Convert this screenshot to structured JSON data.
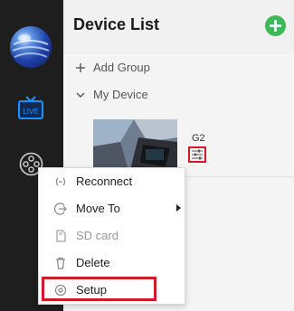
{
  "header": {
    "title": "Device List"
  },
  "tree": {
    "add_group_label": "Add Group",
    "my_device_label": "My Device"
  },
  "device": {
    "name": "G2"
  },
  "sidebar": {
    "live_badge": "LIVE"
  },
  "context_menu": {
    "items": [
      {
        "label": "Reconnect",
        "icon": "reconnect-icon",
        "enabled": true
      },
      {
        "label": "Move To",
        "icon": "move-to-icon",
        "enabled": true,
        "has_submenu": true
      },
      {
        "label": "SD card",
        "icon": "sd-card-icon",
        "enabled": false
      },
      {
        "label": "Delete",
        "icon": "trash-icon",
        "enabled": true
      },
      {
        "label": "Setup",
        "icon": "gear-icon",
        "enabled": true,
        "highlighted": true
      }
    ]
  },
  "colors": {
    "sidebar_bg": "#1e1e1e",
    "accent_green": "#3cba55",
    "highlight_red": "#d0192b",
    "live_blue": "#1e90ff"
  }
}
